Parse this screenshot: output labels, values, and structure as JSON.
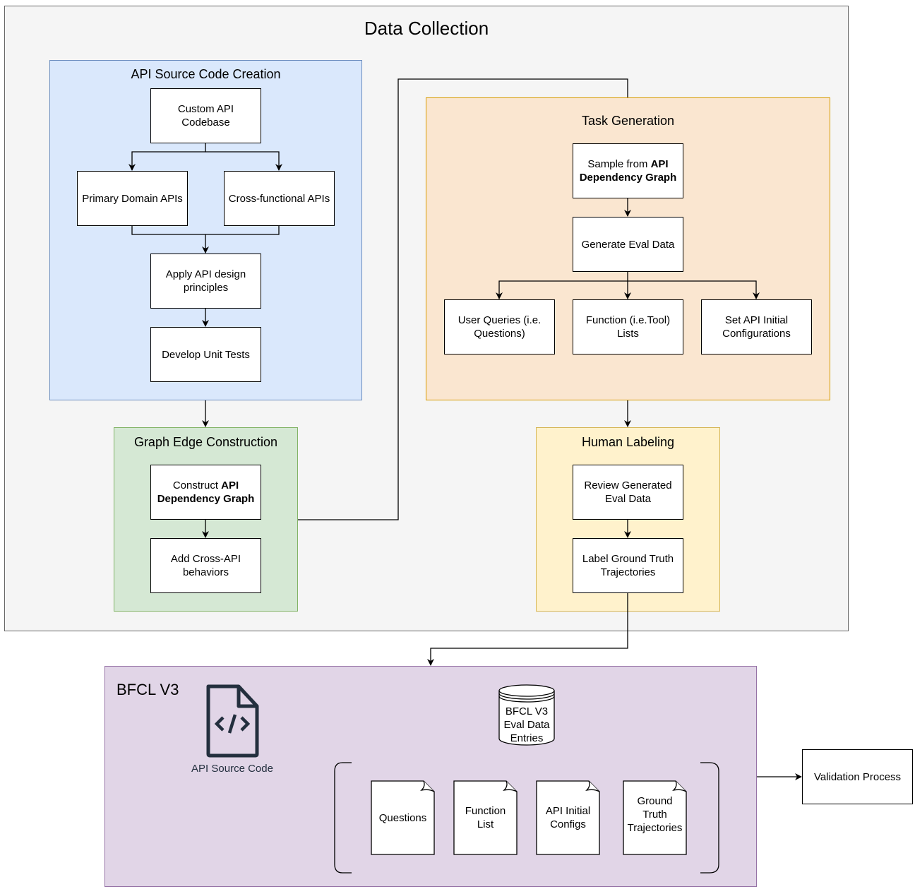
{
  "title": "Data Collection",
  "groups": {
    "api_source": {
      "title": "API Source Code Creation",
      "nodes": {
        "custom_api": "Custom API Codebase",
        "primary_domain": "Primary Domain APIs",
        "cross_functional": "Cross-functional APIs",
        "design_principles": "Apply API design principles",
        "unit_tests": "Develop Unit Tests"
      }
    },
    "graph_edge": {
      "title": "Graph Edge Construction",
      "nodes": {
        "construct_prefix": "Construct ",
        "construct_bold1": "API",
        "construct_bold2": "Dependency Graph",
        "cross_api": "Add Cross-API behaviors"
      }
    },
    "task_generation": {
      "title": "Task Generation",
      "nodes": {
        "sample_prefix": "Sample from ",
        "sample_bold1": "API",
        "sample_bold2": "Dependency Graph",
        "generate_eval": "Generate Eval Data",
        "user_queries": "User Queries (i.e. Questions)",
        "function_lists": "Function (i.e.Tool) Lists",
        "initial_configs": "Set API Initial Configurations"
      }
    },
    "human_labeling": {
      "title": "Human Labeling",
      "nodes": {
        "review": "Review Generated Eval Data",
        "label": "Label Ground Truth Trajectories"
      }
    },
    "bfcl": {
      "title": "BFCL V3",
      "source_code_label": "API Source Code",
      "database_label": "BFCL V3 Eval Data Entries",
      "documents": [
        "Questions",
        "Function List",
        "API Initial Configs",
        "Ground Truth Trajectories"
      ]
    }
  },
  "validation": "Validation Process",
  "colors": {
    "outer_bg": "#f5f5f5",
    "outer_border": "#666666",
    "blue_bg": "#dae8fc",
    "blue_border": "#6c8ebf",
    "green_bg": "#d5e8d4",
    "green_border": "#82b366",
    "orange_bg": "#fae6d0",
    "orange_border": "#d79b00",
    "yellow_bg": "#fff2cc",
    "yellow_border": "#d6b656",
    "purple_bg": "#e1d5e7",
    "purple_border": "#9673a6"
  }
}
